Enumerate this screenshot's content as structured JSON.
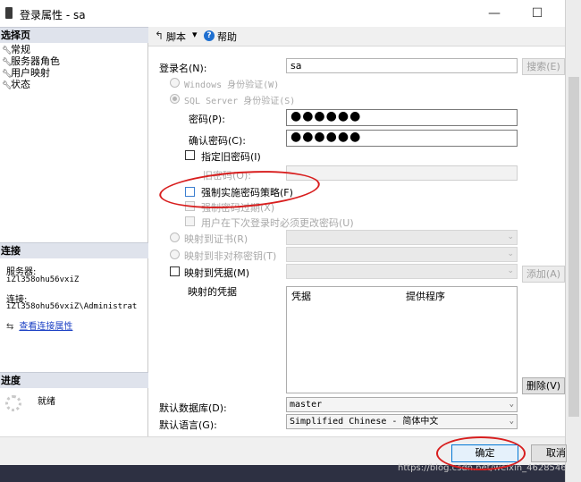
{
  "window": {
    "title": "登录属性 - sa",
    "minimize": "—",
    "maximize": "☐"
  },
  "left_panel": {
    "select_page_header": "选择页",
    "pages": [
      "常规",
      "服务器角色",
      "用户映射",
      "状态"
    ],
    "connection_header": "连接",
    "server_label": "服务器:",
    "server_value": "iZl358ohu56vxiZ",
    "conn_label": "连接:",
    "conn_value": "iZl358ohu56vxiZ\\Administrat",
    "view_conn_link": "查看连接属性",
    "progress_header": "进度",
    "progress_status": "就绪"
  },
  "toolbar": {
    "script": "脚本",
    "script_arrow": "▾",
    "help": "帮助"
  },
  "form": {
    "login_name_label": "登录名(N):",
    "login_name_value": "sa",
    "search_button": "搜索(E)",
    "windows_auth": "Windows 身份验证(W)",
    "sql_auth": "SQL Server 身份验证(S)",
    "password_label": "密码(P):",
    "password_value": "●●●●●●",
    "confirm_label": "确认密码(C):",
    "confirm_value": "●●●●●●",
    "specify_old": "指定旧密码(I)",
    "old_password_label": "旧密码(O):",
    "enforce_policy": "强制实施密码策略(F)",
    "enforce_expiration": "强制密码过期(X)",
    "must_change": "用户在下次登录时必须更改密码(U)",
    "map_cert": "映射到证书(R)",
    "map_asym": "映射到非对称密钥(T)",
    "map_cred": "映射到凭据(M)",
    "add_button": "添加(A)",
    "mapped_creds_label": "映射的凭据",
    "cred_col": "凭据",
    "provider_col": "提供程序",
    "remove_button": "删除(V)",
    "default_db_label": "默认数据库(D):",
    "default_db_value": "master",
    "default_lang_label": "默认语言(G):",
    "default_lang_value": "Simplified Chinese - 简体中文"
  },
  "footer": {
    "ok": "确定",
    "cancel": "取消",
    "watermark": "https://blog.csdn.net/weixin_4628546"
  },
  "colors": {
    "annotation": "#d81e1e",
    "taskbar": "#2d3042",
    "link": "#1a3fc4"
  }
}
